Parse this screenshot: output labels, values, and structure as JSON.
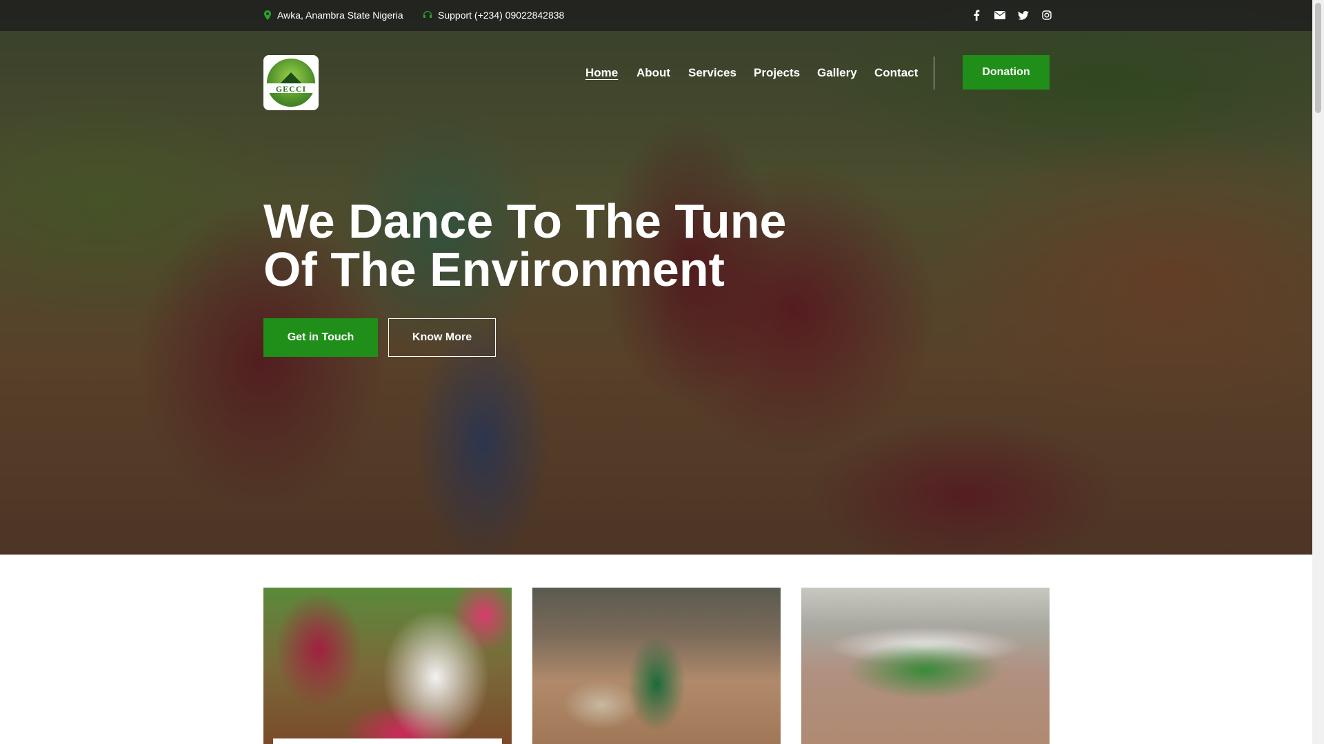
{
  "topbar": {
    "location": "Awka, Anambra State Nigeria",
    "support": "Support (+234) 09022842838",
    "social_icons": [
      "facebook-icon",
      "email-icon",
      "twitter-icon",
      "instagram-icon"
    ]
  },
  "logo": {
    "text": "GECCI"
  },
  "nav": {
    "items": [
      {
        "label": "Home",
        "active": true
      },
      {
        "label": "About"
      },
      {
        "label": "Services"
      },
      {
        "label": "Projects"
      },
      {
        "label": "Gallery"
      },
      {
        "label": "Contact"
      }
    ],
    "donate_label": "Donation"
  },
  "hero": {
    "headline_line1": "We Dance To The Tune",
    "headline_line2": "Of The Environment",
    "primary_button": "Get in Touch",
    "secondary_button": "Know More"
  },
  "colors": {
    "accent_green": "#1f8f1a",
    "topbar_bg": "#1e1e1e",
    "text_white": "#ffffff"
  }
}
